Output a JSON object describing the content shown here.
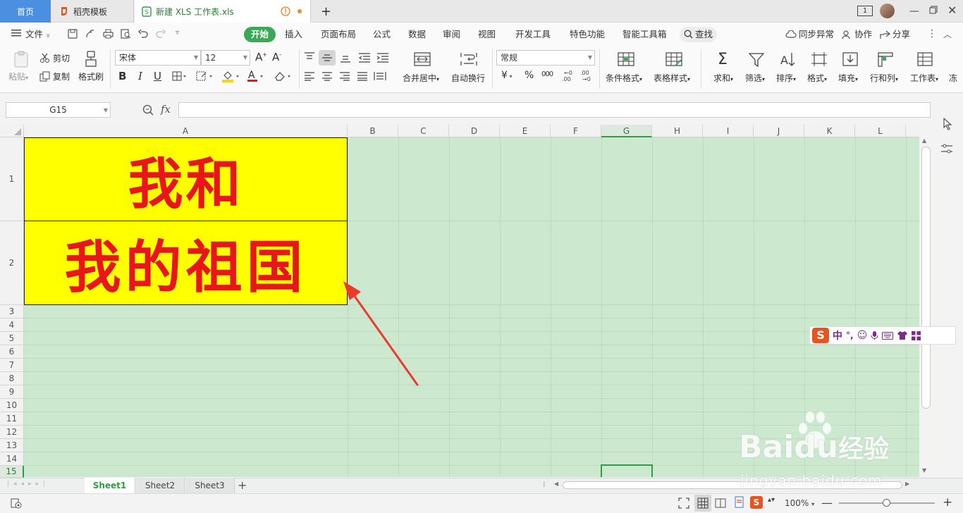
{
  "tabs": {
    "home": "首页",
    "template": "稻壳模板",
    "document": "新建 XLS 工作表.xls"
  },
  "titlebar": {
    "window_badge": "1"
  },
  "menu": {
    "file": "文件",
    "items": [
      "开始",
      "插入",
      "页面布局",
      "公式",
      "数据",
      "审阅",
      "视图",
      "开发工具",
      "特色功能",
      "智能工具箱"
    ],
    "search": "查找",
    "sync": "同步异常",
    "collab": "协作",
    "share": "分享"
  },
  "ribbon": {
    "paste": "粘贴",
    "cut": "剪切",
    "copy": "复制",
    "format_painter": "格式刷",
    "font_name": "宋体",
    "font_size": "12",
    "merge_center": "合并居中",
    "wrap": "自动换行",
    "number_format": "常规",
    "currency": "¥",
    "percent": "%",
    "thousands": "000",
    "conditional_format": "条件格式",
    "table_style": "表格样式",
    "sum": "求和",
    "filter": "筛选",
    "sort": "排序",
    "format": "格式",
    "fill": "填充",
    "row_col": "行和列",
    "worksheet": "工作表"
  },
  "formula_bar": {
    "name_box": "G15",
    "fx": "fx",
    "value": ""
  },
  "columns": [
    "A",
    "B",
    "C",
    "D",
    "E",
    "F",
    "G",
    "H",
    "I",
    "J",
    "K",
    "L"
  ],
  "rows": [
    "1",
    "2",
    "3",
    "4",
    "5",
    "6",
    "7",
    "8",
    "9",
    "10",
    "11",
    "12",
    "13",
    "14",
    "15"
  ],
  "cells": {
    "A1": "我和",
    "A2": "我的祖国"
  },
  "active_cell": "G15",
  "sheets": [
    "Sheet1",
    "Sheet2",
    "Sheet3"
  ],
  "status": {
    "zoom": "100%"
  },
  "ime": {
    "mode": "中",
    "punct": "°,"
  },
  "watermark": {
    "brand": "Baidu",
    "product": "经验",
    "url": "jingyan.baidu.com"
  },
  "colors": {
    "accent": "#3aa856",
    "cell_fill": "#ffff00",
    "cell_text": "#e8161b",
    "eye_protect": "#cce8cf"
  }
}
